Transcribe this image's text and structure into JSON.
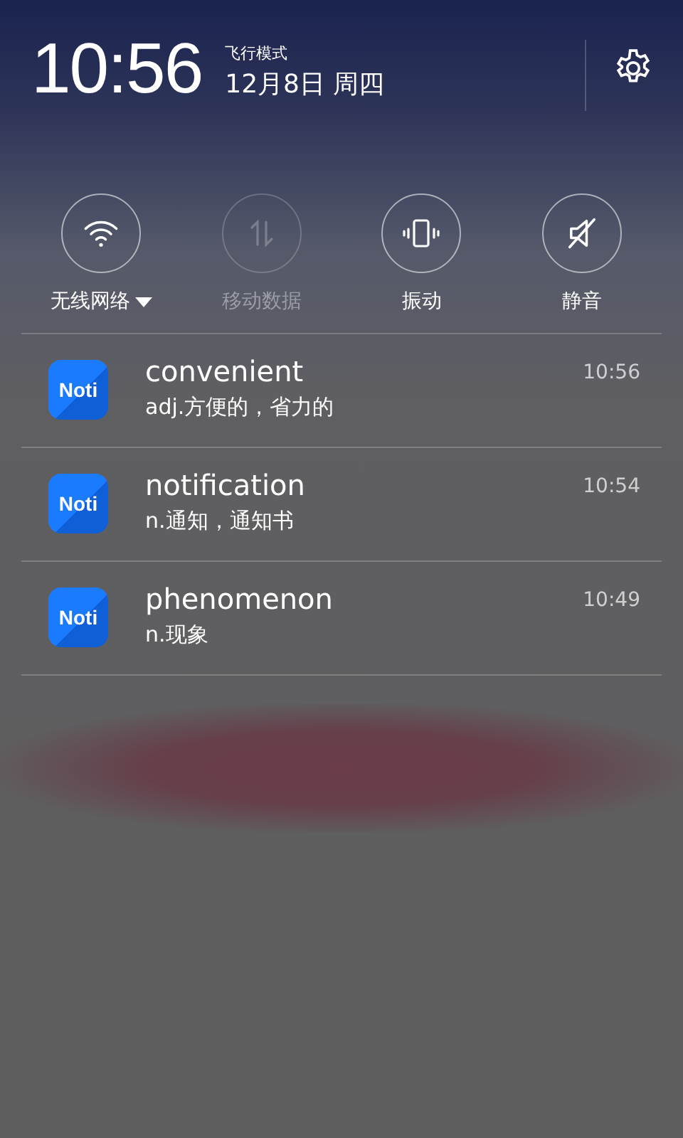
{
  "header": {
    "time": "10:56",
    "mode": "飞行模式",
    "date": "12月8日 周四"
  },
  "toggles": [
    {
      "kind": "wifi",
      "label": "无线网络",
      "disabled": false,
      "menu": true
    },
    {
      "kind": "data",
      "label": "移动数据",
      "disabled": true,
      "menu": false
    },
    {
      "kind": "vibrate",
      "label": "振动",
      "disabled": false,
      "menu": false
    },
    {
      "kind": "mute",
      "label": "静音",
      "disabled": false,
      "menu": false
    }
  ],
  "notifications": [
    {
      "app_icon": "Noti",
      "title": "convenient",
      "text": "adj.方便的，省力的",
      "time": "10:56"
    },
    {
      "app_icon": "Noti",
      "title": "notification",
      "text": "n.通知，通知书",
      "time": "10:54"
    },
    {
      "app_icon": "Noti",
      "title": "phenomenon",
      "text": "n.现象",
      "time": "10:49"
    }
  ]
}
